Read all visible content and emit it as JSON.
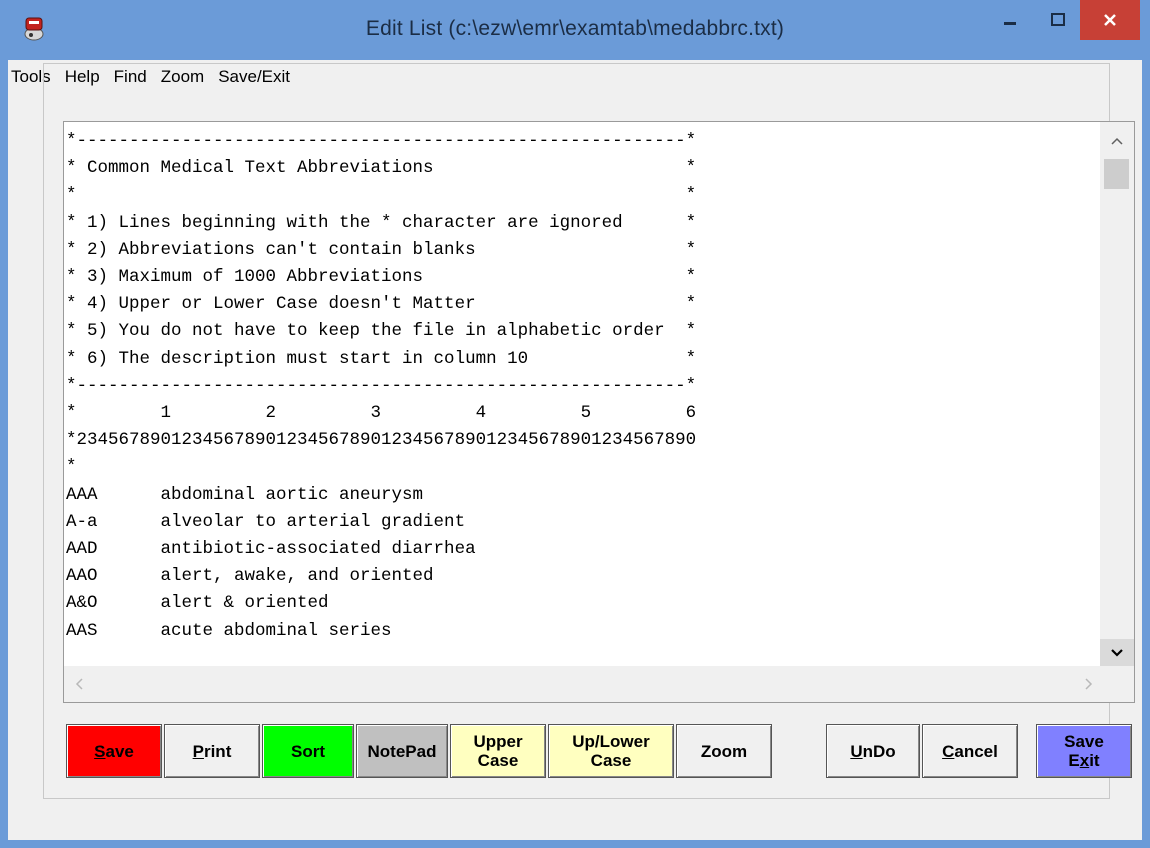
{
  "window": {
    "title": "Edit List (c:\\ezw\\emr\\examtab\\medabbrc.txt)",
    "icon": "app-icon"
  },
  "menu": {
    "items": [
      "Tools",
      "Help",
      "Find",
      "Zoom",
      "Save/Exit"
    ]
  },
  "editor": {
    "lines": [
      "*----------------------------------------------------------*",
      "* Common Medical Text Abbreviations                        *",
      "*                                                          *",
      "* 1) Lines beginning with the * character are ignored      *",
      "* 2) Abbreviations can't contain blanks                    *",
      "* 3) Maximum of 1000 Abbreviations                         *",
      "* 4) Upper or Lower Case doesn't Matter                    *",
      "* 5) You do not have to keep the file in alphabetic order  *",
      "* 6) The description must start in column 10               *",
      "*----------------------------------------------------------*",
      "*        1         2         3         4         5         6",
      "*23456789012345678901234567890123456789012345678901234567890",
      "*",
      "AAA      abdominal aortic aneurysm",
      "A-a      alveolar to arterial gradient",
      "AAD      antibiotic-associated diarrhea",
      "AAO      alert, awake, and oriented",
      "A&O      alert & oriented",
      "AAS      acute abdominal series"
    ]
  },
  "buttons": {
    "save": {
      "underline": "S",
      "rest": "ave",
      "color": "#ff0000"
    },
    "print": {
      "underline": "P",
      "rest": "rint",
      "color": "#f0f0f0"
    },
    "sort": {
      "label": "Sort",
      "color": "#00ff00"
    },
    "notepad": {
      "label": "NotePad",
      "color": "#c0c0c0"
    },
    "upper_case": {
      "label": "Upper\nCase",
      "color": "#ffffc0"
    },
    "up_lower_case": {
      "label": "Up/Lower\nCase",
      "color": "#ffffc0"
    },
    "zoom": {
      "label": "Zoom",
      "color": "#f0f0f0"
    },
    "undo": {
      "underline": "U",
      "rest": "nDo",
      "color": "#f0f0f0"
    },
    "cancel": {
      "underline": "C",
      "rest": "ancel",
      "color": "#f0f0f0"
    },
    "save_exit": {
      "line1": "Save",
      "line2_pre": "E",
      "line2_underline": "x",
      "line2_post": "it",
      "color": "#8080ff"
    }
  }
}
